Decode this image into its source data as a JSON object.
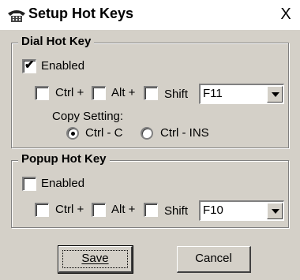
{
  "window": {
    "title": "Setup Hot Keys",
    "close_label": "X"
  },
  "dial": {
    "group_title": "Dial  Hot Key",
    "enabled_label": "Enabled",
    "enabled_checked": true,
    "ctrl_label": "Ctrl +",
    "alt_label": "Alt +",
    "shift_label": "Shift",
    "key_value": "F11",
    "copy_setting_label": "Copy Setting:",
    "radio_ctrl_c_label": "Ctrl - C",
    "radio_ctrl_ins_label": "Ctrl - INS",
    "selected_copy": "Ctrl - C"
  },
  "popup": {
    "group_title": "Popup Hot Key",
    "enabled_label": "Enabled",
    "enabled_checked": false,
    "ctrl_label": "Ctrl +",
    "alt_label": "Alt +",
    "shift_label": "Shift",
    "key_value": "F10"
  },
  "buttons": {
    "save_label": "Save",
    "cancel_label": "Cancel"
  }
}
